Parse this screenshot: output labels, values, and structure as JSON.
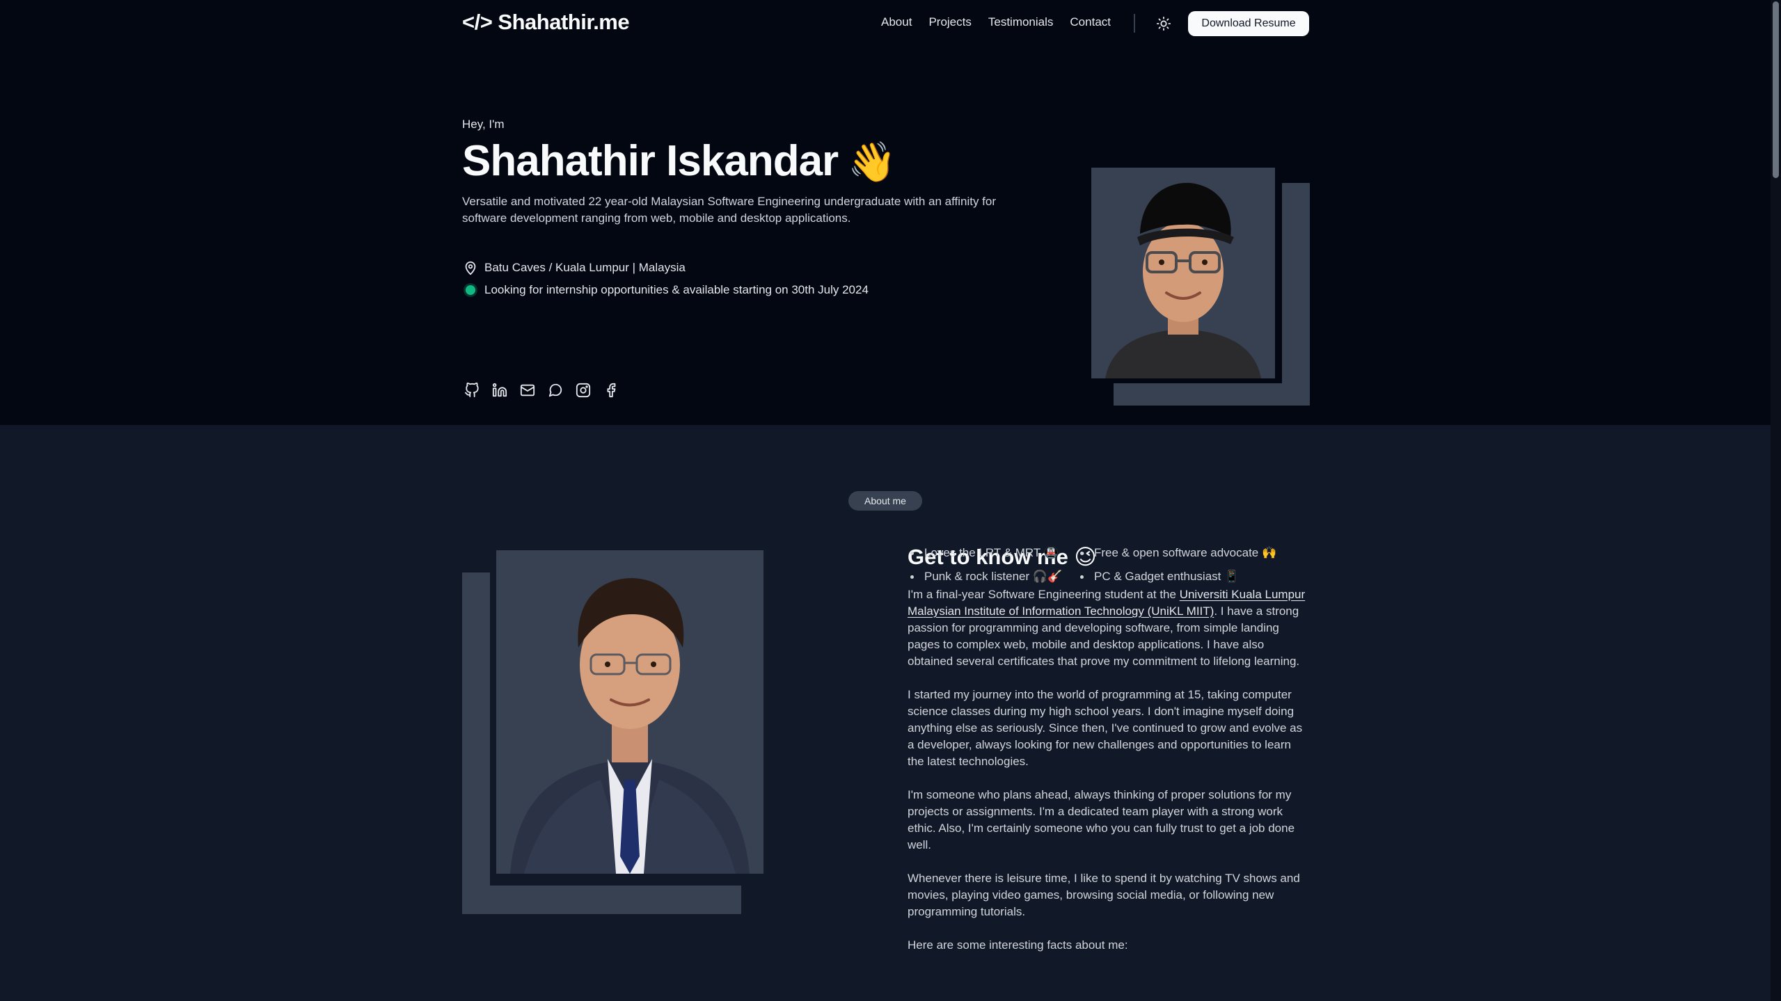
{
  "header": {
    "logo": "</> Shahathir.me",
    "nav": [
      "About",
      "Projects",
      "Testimonials",
      "Contact"
    ],
    "theme_toggle_icon": "sun-icon",
    "resume_button": "Download Resume"
  },
  "hero": {
    "greeting": "Hey, I'm",
    "name": "Shahathir Iskandar",
    "wave": "👋",
    "description": "Versatile and motivated 22 year-old Malaysian Software Engineering undergraduate with an affinity for software development ranging from web, mobile and desktop applications.",
    "location": "Batu Caves / Kuala Lumpur | Malaysia",
    "status": "Looking for internship opportunities & available starting on 30th July 2024",
    "status_color": "#10b981",
    "socials": [
      "github-icon",
      "linkedin-icon",
      "mail-icon",
      "chat-icon",
      "instagram-icon",
      "facebook-icon"
    ]
  },
  "about": {
    "badge": "About me",
    "title": "Get to know me 😉",
    "p1_before": "I'm a final-year Software Engineering student at the ",
    "p1_link": "Universiti Kuala Lumpur Malaysian Institute of Information Technology (UniKL MIIT)",
    "p1_after": ". I have a strong passion for programming and developing software, from simple landing pages to complex web, mobile and desktop applications. I have also obtained several certificates that prove my commitment to lifelong learning.",
    "p2": "I started my journey into the world of programming at 15, taking computer science classes during my high school years. I don't imagine myself doing anything else as seriously. Since then, I've continued to grow and evolve as a developer, always looking for new challenges and opportunities to learn the latest technologies.",
    "p3": "I'm someone who plans ahead, always thinking of proper solutions for my projects or assignments. I'm a dedicated team player with a strong work ethic. Also, I'm certainly someone who you can fully trust to get a job done well.",
    "p4": "Whenever there is leisure time, I like to spend it by watching TV shows and movies, playing video games, browsing social media, or following new programming tutorials.",
    "p5": "Here are some interesting facts about me:",
    "facts": [
      "Loves the LRT & MRT 🚇",
      "Free & open software advocate 🙌",
      "Punk & rock listener 🎧🎸",
      "PC & Gadget enthusiast 📱"
    ]
  },
  "colors": {
    "background": "#030712",
    "section_background": "#111827",
    "accent": "#374151"
  }
}
